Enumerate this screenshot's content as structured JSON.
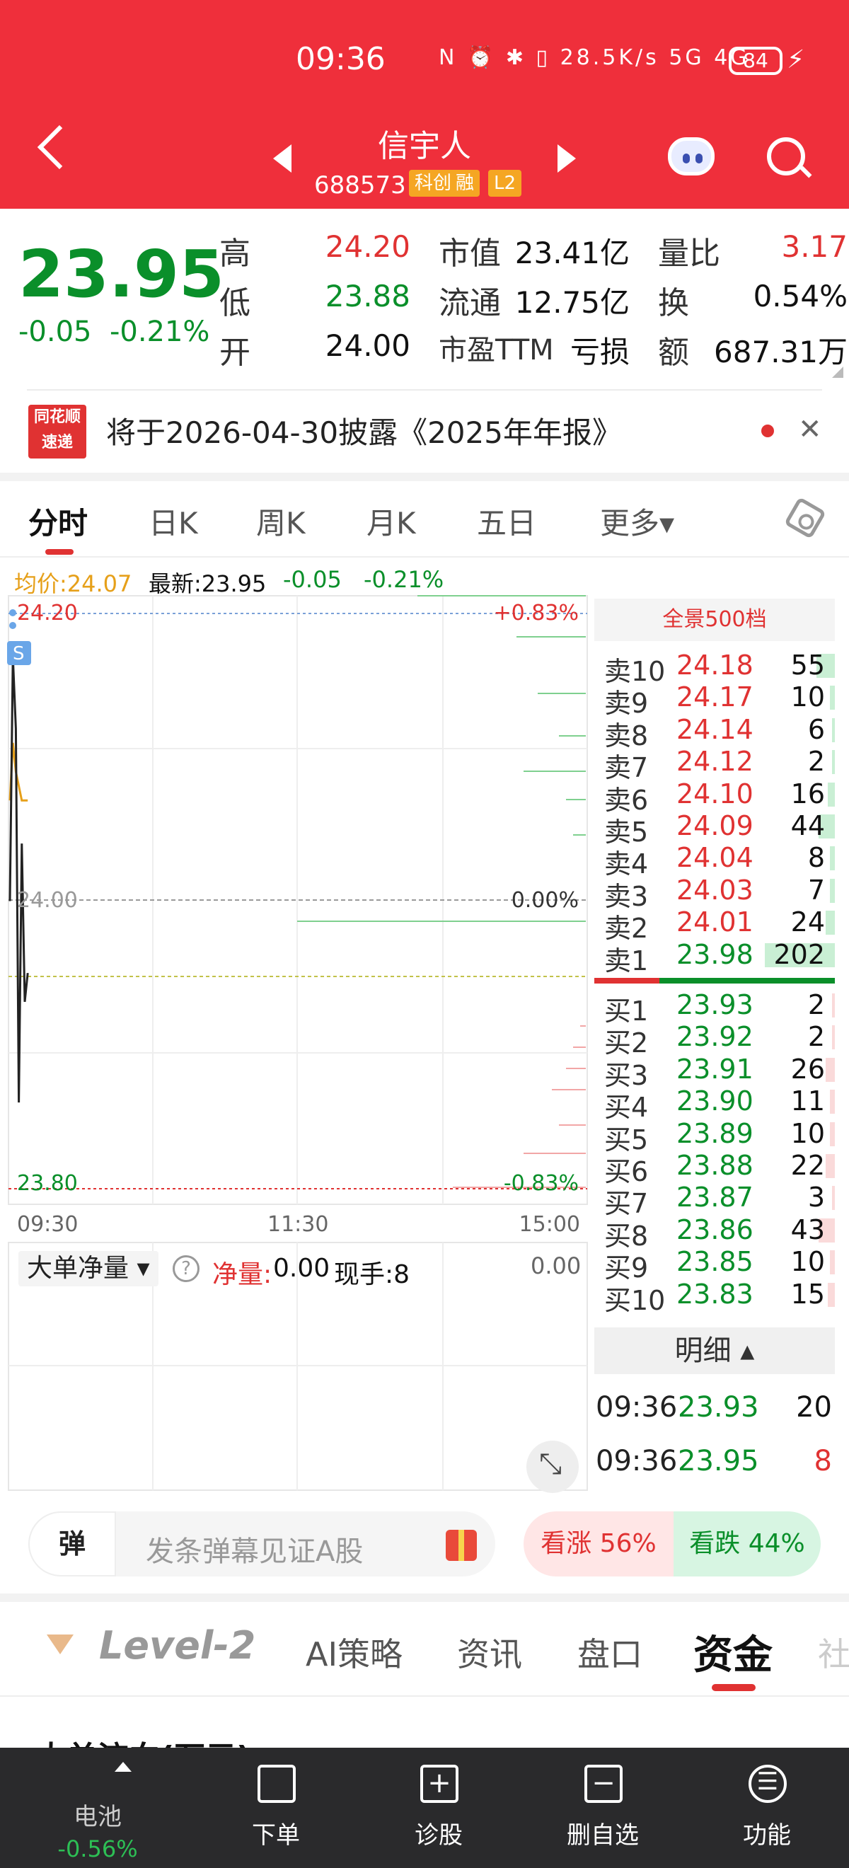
{
  "status": {
    "time": "09:36",
    "icons_text": "N ⏰ ✱ ▯ 28.5K/s 5G 4G",
    "battery": "84"
  },
  "header": {
    "name": "信宇人",
    "code": "688573",
    "badges": [
      "科创",
      "融",
      "L2"
    ]
  },
  "quote": {
    "price": "23.95",
    "change": "-0.05",
    "change_pct": "-0.21%",
    "stats": [
      {
        "label": "高",
        "value": "24.20",
        "color": "#e03232"
      },
      {
        "label": "低",
        "value": "23.88",
        "color": "#0a8f2a"
      },
      {
        "label": "开",
        "value": "24.00",
        "color": "#111111"
      }
    ],
    "mid": [
      {
        "label": "市值",
        "value": "23.41亿"
      },
      {
        "label": "流通",
        "value": "12.75亿"
      },
      {
        "label": "市盈TTM",
        "value": "亏损"
      }
    ],
    "right": [
      {
        "label": "量比",
        "value": "3.17",
        "color": "#e03232"
      },
      {
        "label": "换",
        "value": "0.54%",
        "color": "#111111"
      },
      {
        "label": "额",
        "value": "687.31万",
        "color": "#111111"
      }
    ]
  },
  "notice": {
    "logo_top": "同花顺",
    "logo_bottom": "速递",
    "text": "将于2026-04-30披露《2025年年报》"
  },
  "chart_tabs": [
    "分时",
    "日K",
    "周K",
    "月K",
    "五日",
    "更多▾"
  ],
  "info": {
    "avg": "均价:24.07",
    "latest": "最新:23.95",
    "chg": "-0.05",
    "pct": "-0.21%"
  },
  "chart": {
    "y_top": "24.20",
    "y_mid": "24.00",
    "y_bot": "23.80",
    "pct_top": "+0.83%",
    "pct_mid": "0.00%",
    "pct_bot": "-0.83%",
    "times": [
      "09:30",
      "11:30",
      "15:00"
    ],
    "s_badge": "S"
  },
  "chart_data": {
    "type": "line",
    "ylim": [
      23.8,
      24.2
    ],
    "x": [
      "09:30",
      "09:31",
      "09:32",
      "09:33",
      "09:34",
      "09:35",
      "09:36"
    ],
    "series": [
      {
        "values": [
          24.0,
          24.17,
          24.12,
          23.86,
          24.04,
          23.93,
          23.95
        ]
      },
      {
        "values": [
          24.07,
          24.11,
          24.09,
          24.08,
          24.07,
          24.07,
          24.07
        ]
      }
    ]
  },
  "orderbook": {
    "title": "全景500档",
    "asks": [
      {
        "label": "卖10",
        "price": "24.18",
        "vol": "55",
        "bar": 0.08
      },
      {
        "label": "卖9",
        "price": "24.17",
        "vol": "10",
        "bar": 0.02
      },
      {
        "label": "卖8",
        "price": "24.14",
        "vol": "6",
        "bar": 0.01
      },
      {
        "label": "卖7",
        "price": "24.12",
        "vol": "2",
        "bar": 0.01
      },
      {
        "label": "卖6",
        "price": "24.10",
        "vol": "16",
        "bar": 0.03
      },
      {
        "label": "卖5",
        "price": "24.09",
        "vol": "44",
        "bar": 0.07
      },
      {
        "label": "卖4",
        "price": "24.04",
        "vol": "8",
        "bar": 0.02
      },
      {
        "label": "卖3",
        "price": "24.03",
        "vol": "7",
        "bar": 0.02
      },
      {
        "label": "卖2",
        "price": "24.01",
        "vol": "24",
        "bar": 0.04
      },
      {
        "label": "卖1",
        "price": "23.98",
        "vol": "202",
        "bar": 0.3
      }
    ],
    "bids": [
      {
        "label": "买1",
        "price": "23.93",
        "vol": "2",
        "bar": 0.01
      },
      {
        "label": "买2",
        "price": "23.92",
        "vol": "2",
        "bar": 0.01
      },
      {
        "label": "买3",
        "price": "23.91",
        "vol": "26",
        "bar": 0.04
      },
      {
        "label": "买4",
        "price": "23.90",
        "vol": "11",
        "bar": 0.02
      },
      {
        "label": "买5",
        "price": "23.89",
        "vol": "10",
        "bar": 0.02
      },
      {
        "label": "买6",
        "price": "23.88",
        "vol": "22",
        "bar": 0.04
      },
      {
        "label": "买7",
        "price": "23.87",
        "vol": "3",
        "bar": 0.01
      },
      {
        "label": "买8",
        "price": "23.86",
        "vol": "43",
        "bar": 0.07
      },
      {
        "label": "买9",
        "price": "23.85",
        "vol": "10",
        "bar": 0.02
      },
      {
        "label": "买10",
        "price": "23.83",
        "vol": "15",
        "bar": 0.03
      }
    ],
    "detail_title": "明细 ▴",
    "details": [
      {
        "time": "09:36",
        "price": "23.93",
        "price_color": "#0a8f2a",
        "vol": "20",
        "vol_color": "#111111"
      },
      {
        "time": "09:36",
        "price": "23.95",
        "price_color": "#0a8f2a",
        "vol": "8",
        "vol_color": "#e03232"
      }
    ]
  },
  "indicator": {
    "select": "大单净量 ▾",
    "help": "?",
    "net_label": "净量:",
    "net_value": "0.00",
    "lots": "现手:8",
    "right_value": "0.00"
  },
  "barrage": {
    "tag": "弹",
    "placeholder": "发条弹幕见证A股",
    "up": "看涨 56%",
    "down": "看跌 44%"
  },
  "section_tabs": {
    "level2": "Level-2",
    "tabs": [
      "AI策略",
      "资讯",
      "盘口",
      "资金",
      "社"
    ]
  },
  "cut_text": "大单流向(万元)",
  "bottom_nav": {
    "battery_label": "电池",
    "battery_value": "-0.56%",
    "items": [
      "下单",
      "诊股",
      "删自选",
      "功能"
    ]
  }
}
